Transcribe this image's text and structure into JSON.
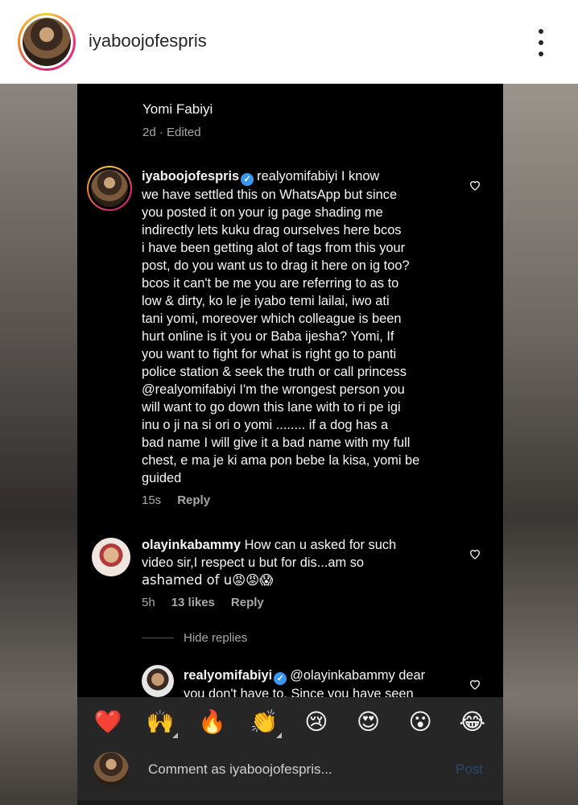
{
  "post_header": {
    "username": "iyaboojofespris"
  },
  "previous_comment": {
    "name": "Yomi Fabiyi",
    "meta": "2d · Edited"
  },
  "comments": [
    {
      "username": "iyaboojofespris",
      "verified": true,
      "lines": [
        "realyomifabiyi I know",
        "we have settled this on WhatsApp but since",
        "you posted it on your ig page shading me",
        "indirectly lets kuku drag ourselves here bcos",
        "i have been getting alot of tags from this your",
        "post, do you want us to drag it here on ig too?",
        "bcos it can't be me you are referring to as to",
        "low & dirty, ko le je iyabo temi lailai, iwo ati",
        "tani yomi, moreover which colleague is been",
        "hurt online is it you or Baba ijesha? Yomi, If",
        "you want to fight for what is right go to panti",
        "police station & seek the truth or call princess",
        "@realyomifabiyi I'm the wrongest person you",
        "will want to go down this lane with to ri pe igi",
        "inu o ji na si ori o yomi  ........ if a dog has a",
        "bad  name I will give it a bad name with my full",
        "chest, e ma je ki ama pon bebe la kisa, yomi be",
        "guided"
      ],
      "time": "15s",
      "reply_label": "Reply"
    },
    {
      "username": "olayinkabammy",
      "verified": false,
      "lines": [
        "How can u asked for such",
        "video sir,I respect u but for dis...am so",
        "ashamed of u😡😡😱"
      ],
      "time": "5h",
      "likes": "13 likes",
      "reply_label": "Reply"
    },
    {
      "username": "realyomifabiyi",
      "verified": true,
      "lines": [
        "@olayinkabammy dear",
        "you don't have to. Since you have seen"
      ]
    }
  ],
  "hide_replies_label": "Hide replies",
  "emoji_bar": [
    "❤️",
    "🙌",
    "🔥",
    "👏",
    "😢",
    "😍",
    "😮",
    "😂"
  ],
  "composer": {
    "placeholder": "Comment as iyaboojofespris...",
    "post_label": "Post"
  },
  "colors": {
    "background": "#000000",
    "composer_bg": "#262626",
    "meta_text": "#a8a8a8",
    "verified_blue": "#3897f0",
    "post_disabled": "#26496d"
  }
}
